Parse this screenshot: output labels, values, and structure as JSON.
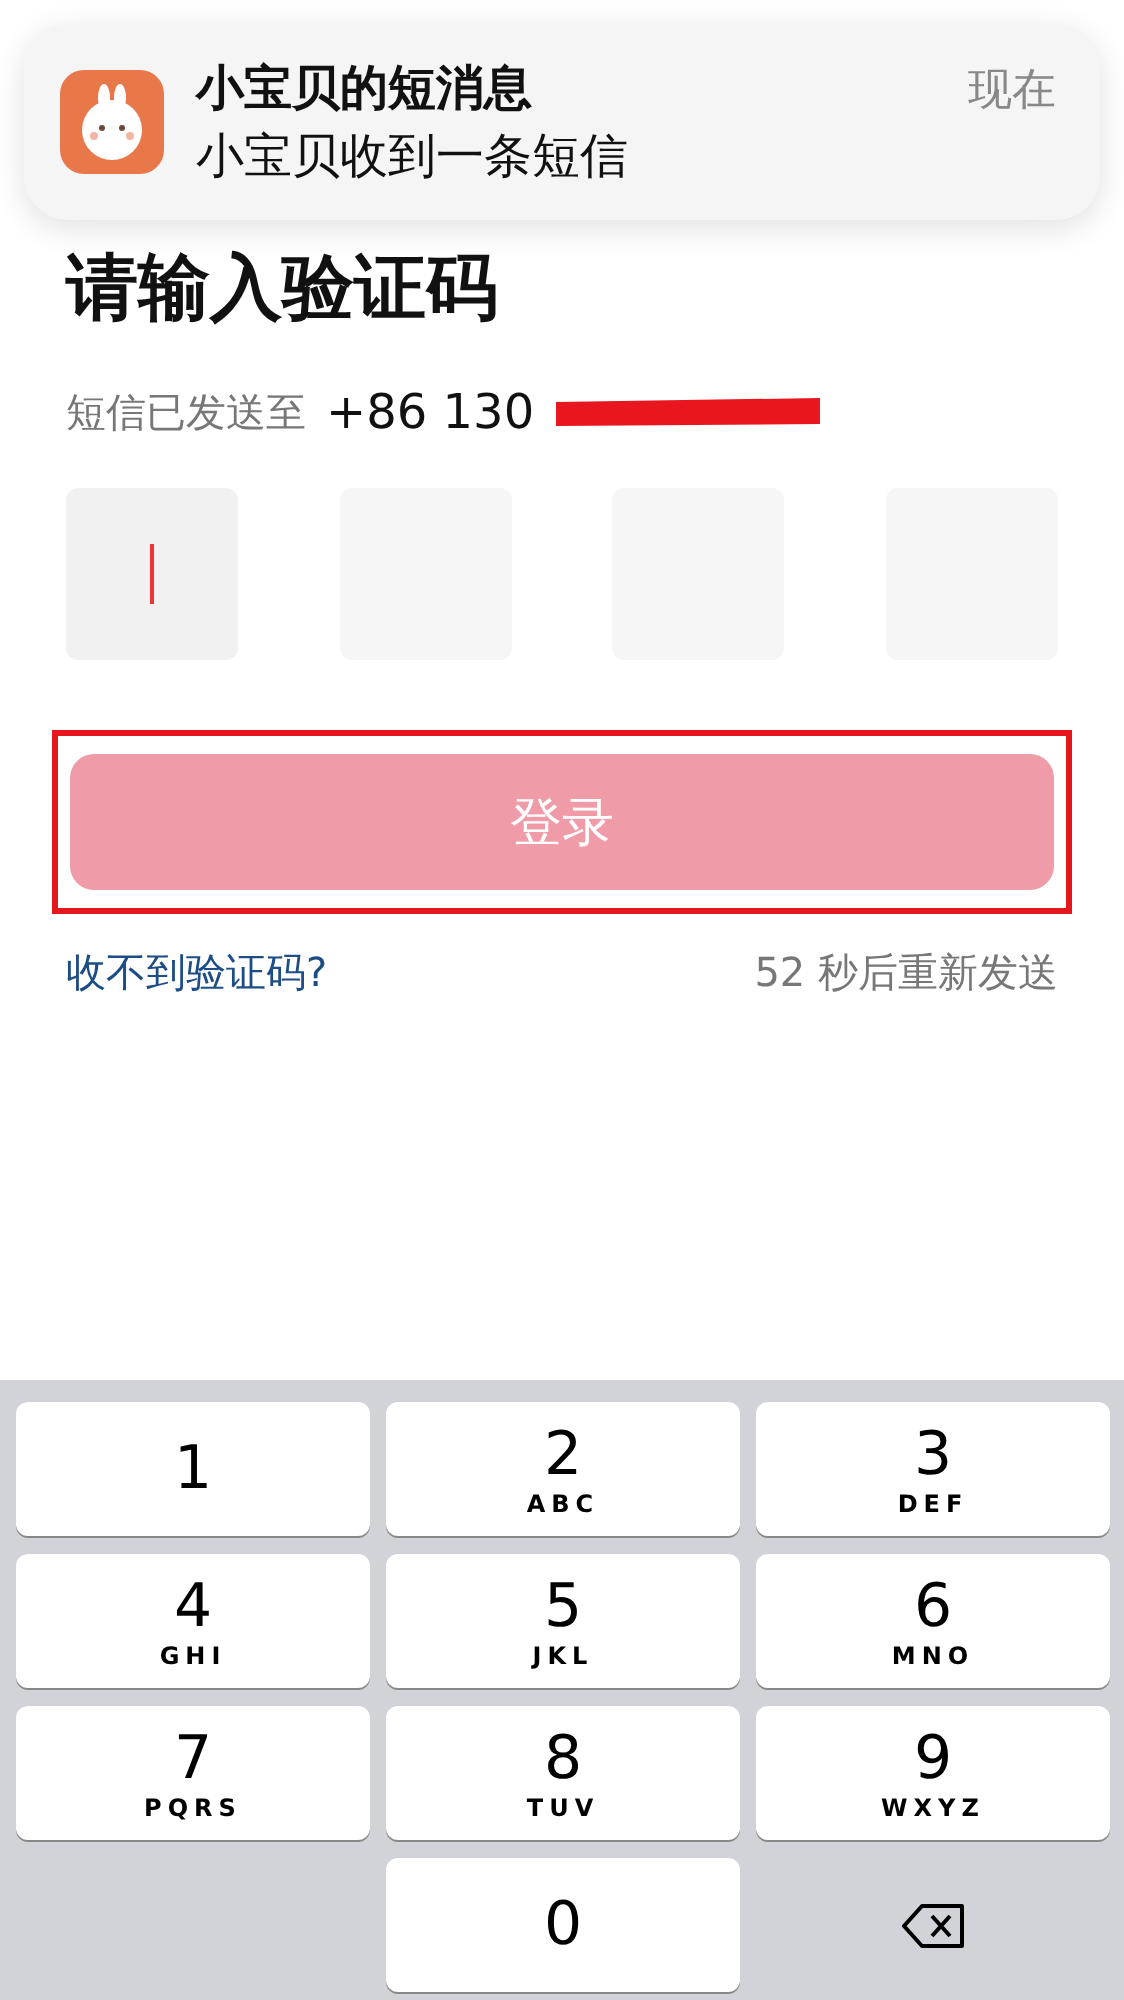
{
  "notification": {
    "title": "小宝贝的短消息",
    "body": "小宝贝收到一条短信",
    "time": "现在"
  },
  "heading": "请输入验证码",
  "sent_to": {
    "label": "短信已发送至",
    "phone": "+86 130"
  },
  "code_boxes": [
    {
      "focused": true
    },
    {
      "focused": false
    },
    {
      "focused": false
    },
    {
      "focused": false
    }
  ],
  "login_button": {
    "label": "登录",
    "highlighted": true
  },
  "help_link": "收不到验证码?",
  "resend": "52 秒后重新发送",
  "keypad": [
    {
      "kind": "digit",
      "digit": "1"
    },
    {
      "kind": "digit",
      "digit": "2",
      "letters": "ABC"
    },
    {
      "kind": "digit",
      "digit": "3",
      "letters": "DEF"
    },
    {
      "kind": "digit",
      "digit": "4",
      "letters": "GHI"
    },
    {
      "kind": "digit",
      "digit": "5",
      "letters": "JKL"
    },
    {
      "kind": "digit",
      "digit": "6",
      "letters": "MNO"
    },
    {
      "kind": "digit",
      "digit": "7",
      "letters": "PQRS"
    },
    {
      "kind": "digit",
      "digit": "8",
      "letters": "TUV"
    },
    {
      "kind": "digit",
      "digit": "9",
      "letters": "WXYZ"
    },
    {
      "kind": "blank"
    },
    {
      "kind": "digit",
      "digit": "0"
    },
    {
      "kind": "delete"
    }
  ]
}
